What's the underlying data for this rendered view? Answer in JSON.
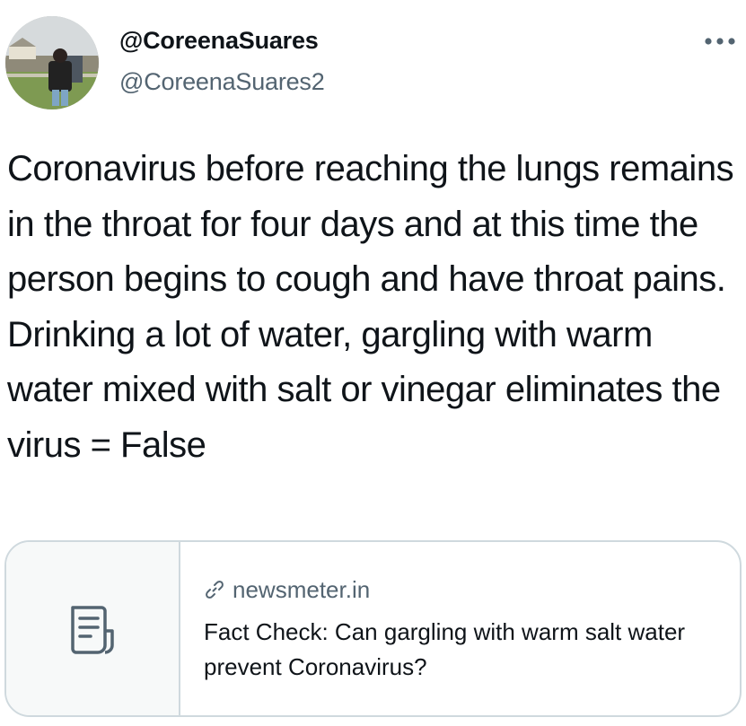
{
  "tweet": {
    "author": {
      "display_name": "@CoreenaSuares",
      "handle": "@CoreenaSuares2",
      "avatar_icon": "profile-photo"
    },
    "more_icon": "more-dots-icon",
    "text": "Coronavirus before reaching the lungs remains in the throat for four days and at this time the person begins to cough and have throat pains. Drinking a lot of water, gargling with warm water mixed with salt or vinegar eliminates the virus = False",
    "link_card": {
      "thumbnail_icon": "document-icon",
      "domain_icon": "link-icon",
      "domain": "newsmeter.in",
      "title": "Fact Check: Can gargling with warm salt water prevent Coronavirus?"
    }
  },
  "colors": {
    "text_primary": "#0f1419",
    "text_secondary": "#536471",
    "card_border": "#cfd9de",
    "card_thumb_bg": "#f7f9f9"
  }
}
